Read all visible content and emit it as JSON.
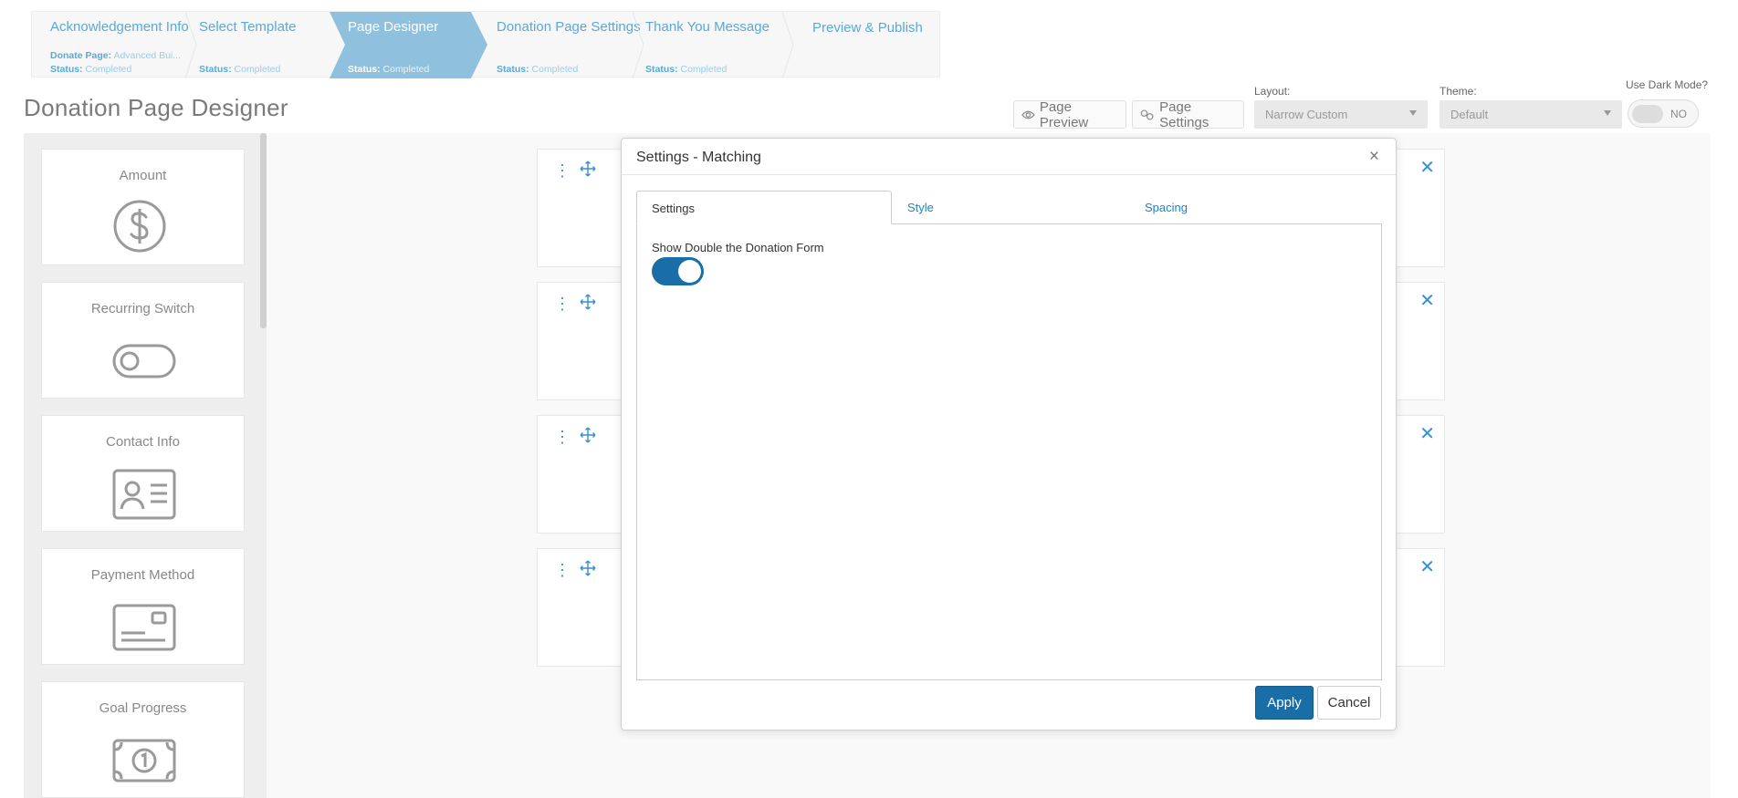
{
  "wizard": {
    "steps": [
      {
        "title": "Acknowledgement Info",
        "sub1_label": "Donate Page:",
        "sub1_value": "Advanced Bui...",
        "status_label": "Status:",
        "status_value": "Completed"
      },
      {
        "title": "Select Template",
        "status_label": "Status:",
        "status_value": "Completed"
      },
      {
        "title": "Page Designer",
        "status_label": "Status:",
        "status_value": "Completed",
        "active": true
      },
      {
        "title": "Donation Page Settings",
        "status_label": "Status:",
        "status_value": "Completed"
      },
      {
        "title": "Thank You Message",
        "status_label": "Status:",
        "status_value": "Completed"
      },
      {
        "title": "Preview & Publish"
      }
    ]
  },
  "page_title": "Donation Page Designer",
  "toolbar": {
    "preview_label": "Page Preview",
    "settings_label": "Page Settings",
    "layout_label": "Layout:",
    "layout_value": "Narrow Custom",
    "theme_label": "Theme:",
    "theme_value": "Default",
    "dark_mode_label": "Use Dark Mode?",
    "dark_mode_value": "NO"
  },
  "palette": {
    "items": [
      {
        "label": "Amount",
        "icon": "dollar-circle-icon"
      },
      {
        "label": "Recurring Switch",
        "icon": "toggle-icon"
      },
      {
        "label": "Contact Info",
        "icon": "contact-card-icon"
      },
      {
        "label": "Payment Method",
        "icon": "credit-card-icon"
      },
      {
        "label": "Goal Progress",
        "icon": "money-bill-icon"
      }
    ]
  },
  "modal": {
    "title": "Settings - Matching",
    "close_glyph": "×",
    "tabs": [
      "Settings",
      "Style",
      "Spacing"
    ],
    "active_tab": "Settings",
    "option_label": "Show Double the Donation Form",
    "option_enabled": true,
    "apply_label": "Apply",
    "cancel_label": "Cancel"
  },
  "colors": {
    "accent": "#1a6ea8",
    "wizard_active": "#8fc0de",
    "link": "#1a86c8"
  }
}
